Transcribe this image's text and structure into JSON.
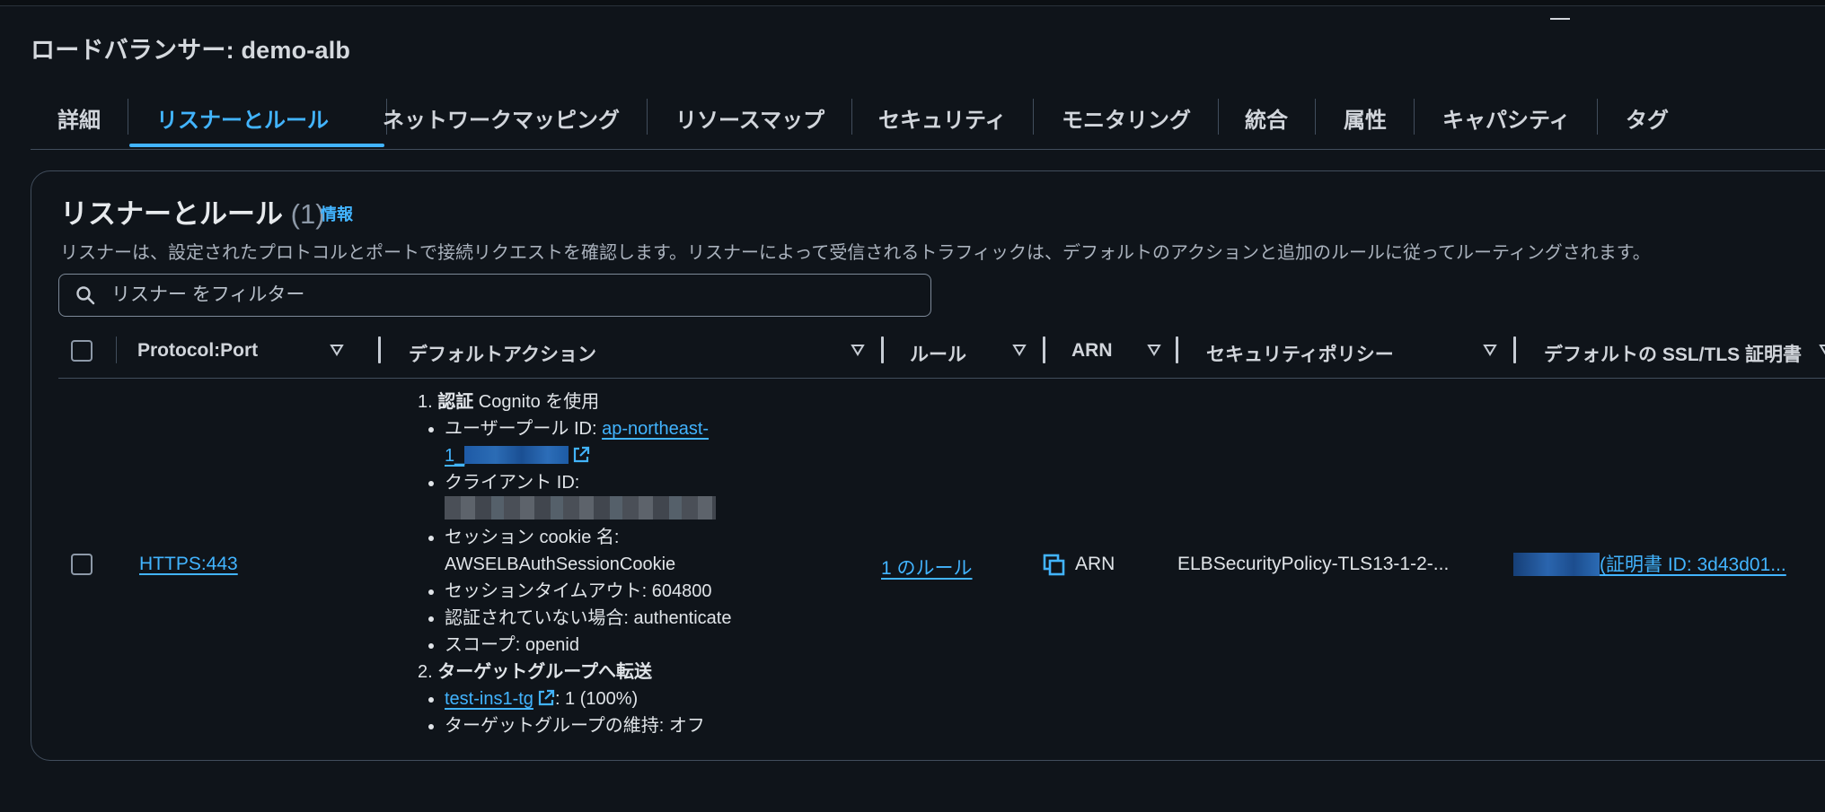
{
  "page": {
    "title": "ロードバランサー: demo-alb"
  },
  "tabs": [
    {
      "label": "詳細"
    },
    {
      "label": "リスナーとルール"
    },
    {
      "label": "ネットワークマッピング"
    },
    {
      "label": "リソースマップ"
    },
    {
      "label": "セキュリティ"
    },
    {
      "label": "モニタリング"
    },
    {
      "label": "統合"
    },
    {
      "label": "属性"
    },
    {
      "label": "キャパシティ"
    },
    {
      "label": "タグ"
    }
  ],
  "panel": {
    "title": "リスナーとルール",
    "count": "(1)",
    "info": "情報",
    "description": "リスナーは、設定されたプロトコルとポートで接続リクエストを確認します。リスナーによって受信されるトラフィックは、デフォルトのアクションと追加のルールに従ってルーティングされます。",
    "filter_placeholder": "リスナー をフィルター"
  },
  "columns": [
    {
      "label": "Protocol:Port"
    },
    {
      "label": "デフォルトアクション"
    },
    {
      "label": "ルール"
    },
    {
      "label": "ARN"
    },
    {
      "label": "セキュリティポリシー"
    },
    {
      "label": "デフォルトの SSL/TLS 証明書"
    }
  ],
  "row": {
    "protocol_port": "HTTPS:443",
    "actions": {
      "a1_num": "1.",
      "a1_title": "認証",
      "a1_rest": " Cognito を使用",
      "user_pool_label": "ユーザープール ID: ",
      "user_pool_link_1": "ap-northeast-",
      "user_pool_link_2": "1_",
      "client_id_label": "クライアント ID:",
      "cookie_label": "セッション cookie 名:",
      "cookie_value": "AWSELBAuthSessionCookie",
      "timeout": "セッションタイムアウト: 604800",
      "unauth": "認証されていない場合: authenticate",
      "scope": "スコープ: openid",
      "a2_num": "2.",
      "a2_title": "ターゲットグループへ転送",
      "tg_link": "test-ins1-tg",
      "tg_weight": ": 1 (100%)",
      "stickiness": "ターゲットグループの維持: オフ"
    },
    "rules": "1 のルール",
    "arn": "ARN",
    "security_policy": "ELBSecurityPolicy-TLS13-1-2-...",
    "certificate": "(証明書 ID: 3d43d01..."
  },
  "icons": {
    "search": "search-icon",
    "sort": "sort-caret-icon",
    "external": "external-link-icon",
    "copy": "copy-icon"
  },
  "colors": {
    "background": "#0f141a",
    "accent": "#42b4ff",
    "border": "#414d5c",
    "text": "#dfe3e8"
  }
}
